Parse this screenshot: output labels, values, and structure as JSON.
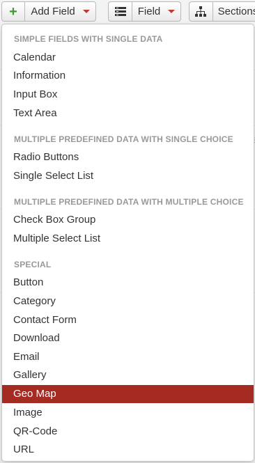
{
  "toolbar": {
    "add_field_label": "Add Field",
    "field_label": "Field",
    "sections_label": "Sections"
  },
  "colors": {
    "accent": "#a52a22",
    "add_icon": "#3f9a2f",
    "caret": "#c0392b",
    "header_text": "#999999"
  },
  "menu": {
    "sections": [
      {
        "header": "SIMPLE FIELDS WITH SINGLE DATA",
        "items": [
          "Calendar",
          "Information",
          "Input Box",
          "Text Area"
        ]
      },
      {
        "header": "MULTIPLE PREDEFINED DATA WITH SINGLE CHOICE",
        "items": [
          "Radio Buttons",
          "Single Select List"
        ]
      },
      {
        "header": "MULTIPLE PREDEFINED DATA WITH MULTIPLE CHOICE",
        "items": [
          "Check Box Group",
          "Multiple Select List"
        ]
      },
      {
        "header": "SPECIAL",
        "items": [
          "Button",
          "Category",
          "Contact Form",
          "Download",
          "Email",
          "Gallery",
          "Geo Map",
          "Image",
          "QR-Code",
          "URL"
        ]
      }
    ],
    "highlighted_item": "Geo Map"
  }
}
